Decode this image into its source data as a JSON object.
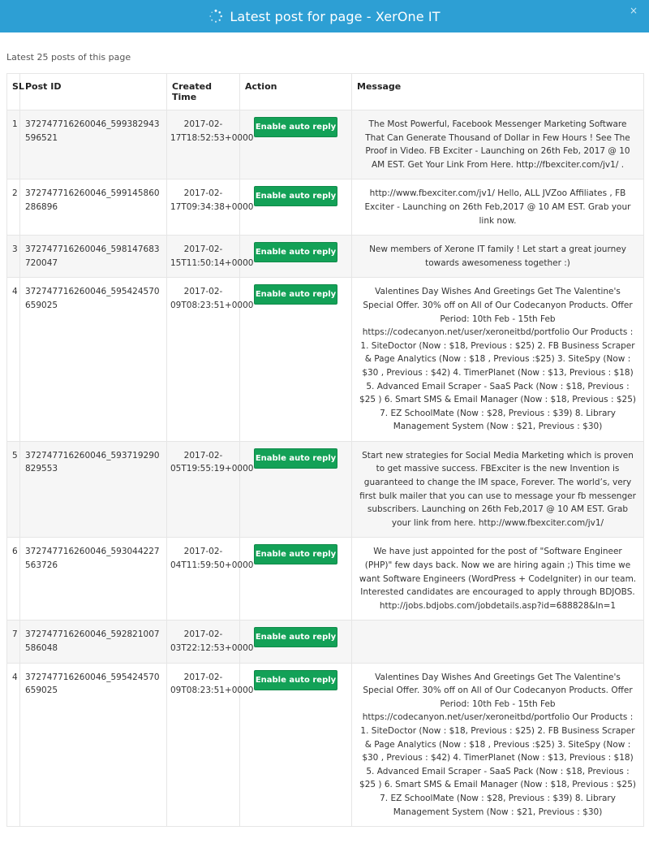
{
  "modal": {
    "title": "Latest post for page - XerOne IT",
    "close_label": "×",
    "subtitle": "Latest 25 posts of this page",
    "spinner_icon": "loading-spinner-icon"
  },
  "colors": {
    "header": "#2d9fd4",
    "button": "#13a157"
  },
  "table": {
    "headers": {
      "sl": "SL",
      "post_id": "Post ID",
      "created": "Created Time",
      "action": "Action",
      "message": "Message"
    },
    "rows": [
      {
        "sl": "1",
        "post_id": "372747716260046_599382943596521",
        "created": "2017-02-17T18:52:53+0000",
        "action": "Enable auto reply",
        "message": "The Most Powerful, Facebook Messenger Marketing Software That Can Generate Thousand of Dollar in Few Hours ! See The Proof in Video. FB Exciter - Launching on 26th Feb, 2017 @ 10 AM EST. Get Your Link From Here. http://fbexciter.com/jv1/ ."
      },
      {
        "sl": "2",
        "post_id": "372747716260046_599145860286896",
        "created": "2017-02-17T09:34:38+0000",
        "action": "Enable auto reply",
        "message": "http://www.fbexciter.com/jv1/ Hello, ALL JVZoo Affiliates , FB Exciter - Launching on 26th Feb,2017 @ 10 AM EST. Grab your link now."
      },
      {
        "sl": "3",
        "post_id": "372747716260046_598147683720047",
        "created": "2017-02-15T11:50:14+0000",
        "action": "Enable auto reply",
        "message": "New members of Xerone IT family ! Let start a great journey towards awesomeness together :)"
      },
      {
        "sl": "4",
        "post_id": "372747716260046_595424570659025",
        "created": "2017-02-09T08:23:51+0000",
        "action": "Enable auto reply",
        "message": "Valentines Day Wishes And Greetings Get The Valentine's Special Offer. 30% off on All of Our Codecanyon Products. Offer Period: 10th Feb - 15th Feb https://codecanyon.net/user/xeroneitbd/portfolio Our Products : 1. SiteDoctor (Now : $18, Previous : $25) 2. FB Business Scraper & Page Analytics (Now : $18 , Previous :$25) 3. SiteSpy (Now : $30 , Previous : $42) 4. TimerPlanet (Now : $13, Previous : $18) 5. Advanced Email Scraper - SaaS Pack (Now : $18, Previous : $25 ) 6. Smart SMS & Email Manager (Now : $18, Previous : $25) 7. EZ SchoolMate (Now : $28, Previous : $39) 8. Library Management System (Now : $21, Previous : $30)"
      },
      {
        "sl": "5",
        "post_id": "372747716260046_593719290829553",
        "created": "2017-02-05T19:55:19+0000",
        "action": "Enable auto reply",
        "message": "Start new strategies for Social Media Marketing which is proven to get massive success. FBExciter is the new Invention is guaranteed to change the IM space, Forever. The world’s, very first bulk mailer that you can use to message your fb messenger subscribers. Launching on 26th Feb,2017 @ 10 AM EST. Grab your link from here. http://www.fbexciter.com/jv1/"
      },
      {
        "sl": "6",
        "post_id": "372747716260046_593044227563726",
        "created": "2017-02-04T11:59:50+0000",
        "action": "Enable auto reply",
        "message": "We have just appointed for the post of \"Software Engineer (PHP)\" few days back. Now we are hiring again ;) This time we want Software Engineers (WordPress + CodeIgniter) in our team. Interested candidates are encouraged to apply through BDJOBS. http://jobs.bdjobs.com/jobdetails.asp?id=688828&ln=1"
      },
      {
        "sl": "7",
        "post_id": "372747716260046_592821007586048",
        "created": "2017-02-03T22:12:53+0000",
        "action": "Enable auto reply",
        "message": ""
      },
      {
        "sl": "4",
        "post_id": "372747716260046_595424570659025",
        "created": "2017-02-09T08:23:51+0000",
        "action": "Enable auto reply",
        "message": "Valentines Day Wishes And Greetings Get The Valentine's Special Offer. 30% off on All of Our Codecanyon Products. Offer Period: 10th Feb - 15th Feb https://codecanyon.net/user/xeroneitbd/portfolio Our Products : 1. SiteDoctor (Now : $18, Previous : $25) 2. FB Business Scraper & Page Analytics (Now : $18 , Previous :$25) 3. SiteSpy (Now : $30 , Previous : $42) 4. TimerPlanet (Now : $13, Previous : $18) 5. Advanced Email Scraper - SaaS Pack (Now : $18, Previous : $25 ) 6. Smart SMS & Email Manager (Now : $18, Previous : $25) 7. EZ SchoolMate (Now : $28, Previous : $39) 8. Library Management System (Now : $21, Previous : $30)"
      }
    ]
  }
}
